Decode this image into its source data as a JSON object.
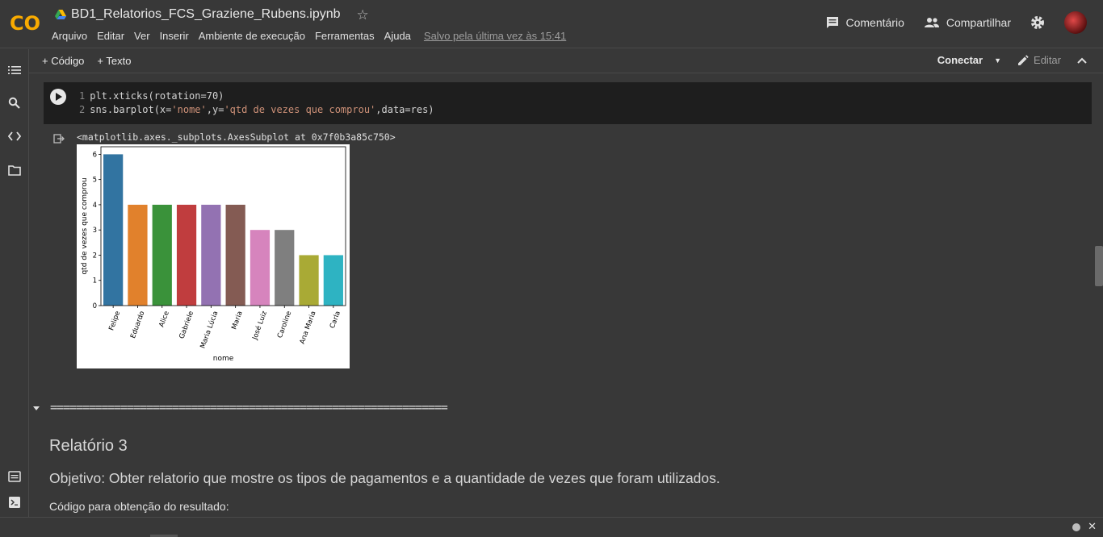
{
  "app": {
    "logo_text": "CO",
    "notebook_title": "BD1_Relatorios_FCS_Graziene_Rubens.ipynb",
    "menu": [
      "Arquivo",
      "Editar",
      "Ver",
      "Inserir",
      "Ambiente de execução",
      "Ferramentas",
      "Ajuda"
    ],
    "saved_status": "Salvo pela última vez às 15:41",
    "comment_label": "Comentário",
    "share_label": "Compartilhar"
  },
  "toolbar": {
    "add_code_label": "+ Código",
    "add_text_label": "+ Texto",
    "connect_label": "Conectar",
    "edit_label": "Editar"
  },
  "cell": {
    "line_numbers": [
      "1",
      "2"
    ],
    "line1": "plt.xticks(rotation=70)",
    "line2_prefix": "sns.barplot(x=",
    "line2_str1": "'nome'",
    "line2_mid": ",y=",
    "line2_str2": "'qtd de vezes que comprou'",
    "line2_suffix": ",data=res)"
  },
  "output": {
    "repr_text": "<matplotlib.axes._subplots.AxesSubplot at 0x7f0b3a85c750>"
  },
  "chart_data": {
    "type": "bar",
    "categories": [
      "Felipe",
      "Eduardo",
      "Alice",
      "Gabriele",
      "Maria Lúcia",
      "Maria",
      "José Luiz",
      "Caroline",
      "Ana Maria",
      "Carla"
    ],
    "values": [
      6,
      4,
      4,
      4,
      4,
      4,
      3,
      3,
      2,
      2
    ],
    "colors": [
      "#3274a1",
      "#e1812c",
      "#3a923a",
      "#c03d3e",
      "#9372b2",
      "#845b53",
      "#d684bd",
      "#7f7f7f",
      "#a9aa35",
      "#2eb3c2"
    ],
    "xlabel": "nome",
    "ylabel": "qtd de vezes que comprou",
    "ylim": [
      0,
      6.3
    ],
    "yticks": [
      0,
      1,
      2,
      3,
      4,
      5,
      6
    ],
    "xtick_rotation": 70,
    "grid": false
  },
  "text_cell": {
    "separator": "==============================================================",
    "title": "Relatório 3",
    "objective": "Objetivo: Obter relatorio que mostre os tipos de pagamentos e a quantidade de vezes que foram utilizados.",
    "code_label": "Código para obtenção do resultado:"
  },
  "colors": {
    "background": "#383838",
    "code_background": "#1e1e1e",
    "string": "#ce9178",
    "logo_orange": "#f9ab00"
  }
}
